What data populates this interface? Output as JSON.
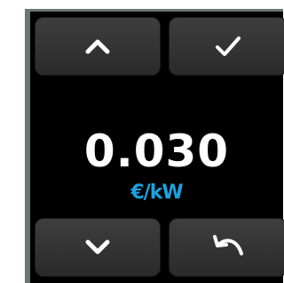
{
  "display": {
    "value": "0.030",
    "unit": "€/kW"
  },
  "buttons": {
    "up": {
      "icon": "chevron-up-icon"
    },
    "confirm": {
      "icon": "checkmark-icon"
    },
    "down": {
      "icon": "chevron-down-icon"
    },
    "back": {
      "icon": "undo-arrow-icon"
    }
  },
  "colors": {
    "screen_background": "#000000",
    "bezel": "#6b7774",
    "button_face": "#333333",
    "value_text": "#ffffff",
    "unit_text": "#1aa3e0"
  }
}
